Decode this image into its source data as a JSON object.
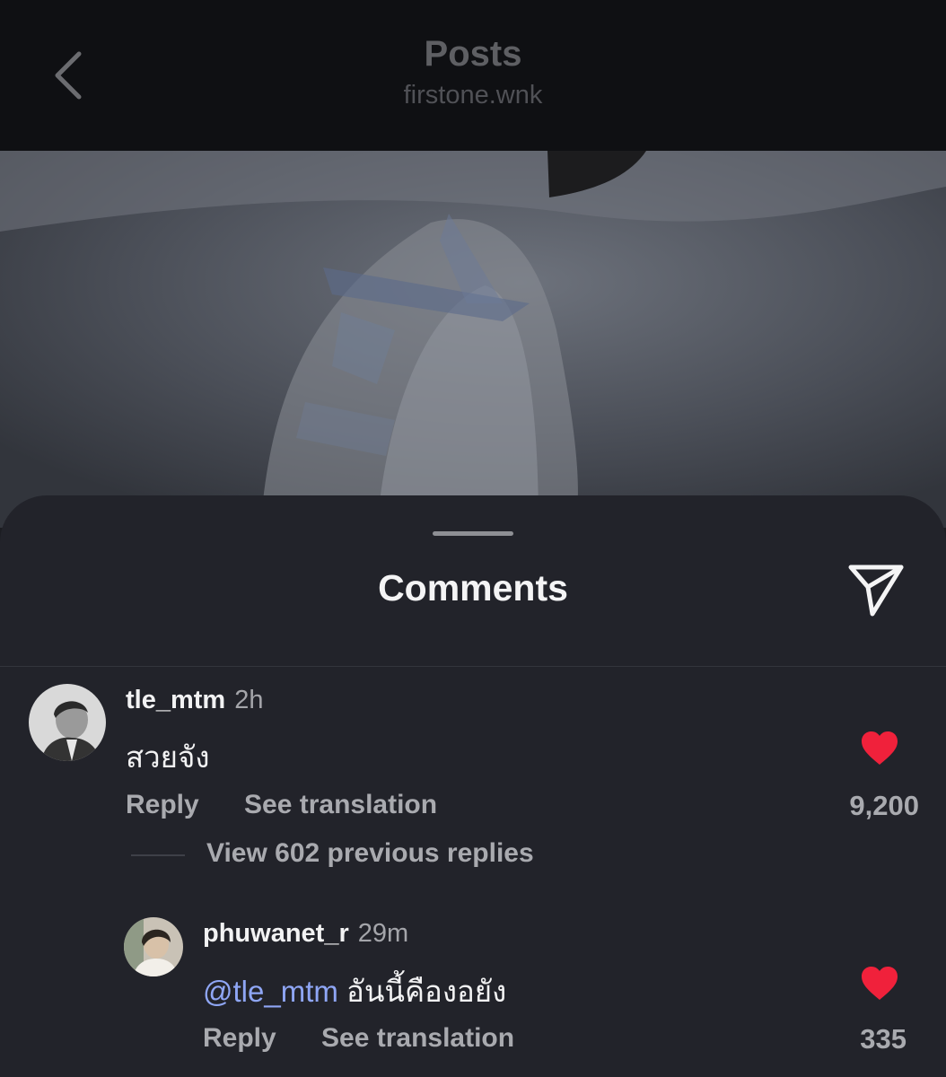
{
  "header": {
    "title": "Posts",
    "username": "firstone.wnk",
    "back_icon": "chevron-left-icon"
  },
  "post": {
    "image_description": "dimmed photo of white costume with blue ornaments"
  },
  "comments_sheet": {
    "title": "Comments",
    "share_icon": "paper-plane-icon"
  },
  "comments": [
    {
      "username": "tle_mtm",
      "time": "2h",
      "text": "สวยจัง",
      "reply_label": "Reply",
      "translate_label": "See translation",
      "likes": "9,200",
      "view_replies_label": "View 602 previous replies"
    },
    {
      "username": "phuwanet_r",
      "time": "29m",
      "mention": "@tle_mtm",
      "text": "อันนี้คืองอยัง",
      "reply_label": "Reply",
      "translate_label": "See translation",
      "likes": "335"
    }
  ],
  "colors": {
    "like": "#f0213b",
    "mention": "#8fa6f5"
  }
}
